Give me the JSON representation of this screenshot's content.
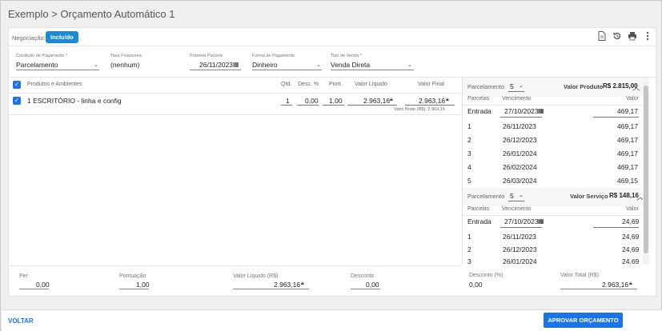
{
  "title": "Exemplo > Orçamento Automático 1",
  "negociacao": {
    "label": "Negociação:",
    "badge": "Incluído"
  },
  "toolbar": {
    "icons": [
      "document-icon",
      "history-icon",
      "print-icon",
      "more-vertical-icon"
    ]
  },
  "fields": {
    "condicao": {
      "label": "Condição de Pagamento *",
      "value": "Parcelamento"
    },
    "taxa": {
      "label": "Taxa Financeira",
      "value": "(nenhum)"
    },
    "primeira": {
      "label": "Primeira Parcela",
      "value": "26/11/2023"
    },
    "forma": {
      "label": "Forma de Pagamento",
      "value": "Dinheiro"
    },
    "tipo": {
      "label": "Tipo de Venda *",
      "value": "Venda Direta"
    }
  },
  "products": {
    "headers": {
      "name": "Produtos e Ambientes",
      "qtd": "Qtd.",
      "desc": "Desc. %",
      "pont": "Pont.",
      "liquido": "Valor Líquido",
      "final": "Valor Final"
    },
    "row": {
      "name": "1 ESCRITÓRIO - linha e config",
      "qtd": "1",
      "desc": "0,00",
      "pont": "1,00",
      "liquido": "2.963,16",
      "final": "2.963,16",
      "bruto": "Valor Bruto (R$): 2.963,16"
    }
  },
  "totals": {
    "per": {
      "label": "Per",
      "value": "0,00"
    },
    "pontuacao": {
      "label": "Pontuação",
      "value": "1,00"
    },
    "liquido": {
      "label": "Valor Líquido (R$)",
      "value": "2.963,16"
    },
    "desconto": {
      "label": "Desconto",
      "value": "0,00"
    },
    "desc_pct": {
      "label": "Desconto (%)",
      "value": "0,00"
    },
    "total": {
      "label": "Valor Total (R$)",
      "value": "2.963,16"
    }
  },
  "produto_section": {
    "parc_label": "Parcelamento",
    "parc_value": "5",
    "valor_label": "Valor Produto",
    "valor": "R$ 2.815,00",
    "headers": {
      "parcelas": "Parcelas",
      "vencimento": "Vencimento",
      "valor": "Valor"
    },
    "entrada": {
      "label": "Entrada",
      "date": "27/10/2023",
      "value": "469,17"
    },
    "rows": [
      {
        "n": "1",
        "date": "26/11/2023",
        "value": "469,17"
      },
      {
        "n": "2",
        "date": "26/12/2023",
        "value": "469,17"
      },
      {
        "n": "3",
        "date": "26/01/2024",
        "value": "469,17"
      },
      {
        "n": "4",
        "date": "26/02/2024",
        "value": "469,17"
      },
      {
        "n": "5",
        "date": "26/03/2024",
        "value": "469,15"
      }
    ]
  },
  "servico_section": {
    "parc_label": "Parcelamento",
    "parc_value": "5",
    "valor_label": "Valor Serviço",
    "valor": "R$ 148,16",
    "headers": {
      "parcelas": "Parcelas",
      "vencimento": "Vencimento",
      "valor": "Valor"
    },
    "entrada": {
      "label": "Entrada",
      "date": "27/10/2023",
      "value": "24,69"
    },
    "rows": [
      {
        "n": "1",
        "date": "26/11/2023",
        "value": "24,69"
      },
      {
        "n": "2",
        "date": "26/12/2023",
        "value": "24,69"
      },
      {
        "n": "3",
        "date": "26/01/2024",
        "value": "24,69"
      }
    ]
  },
  "footer": {
    "voltar": "VOLTAR",
    "aprovar": "APROVAR ORÇAMENTO"
  }
}
